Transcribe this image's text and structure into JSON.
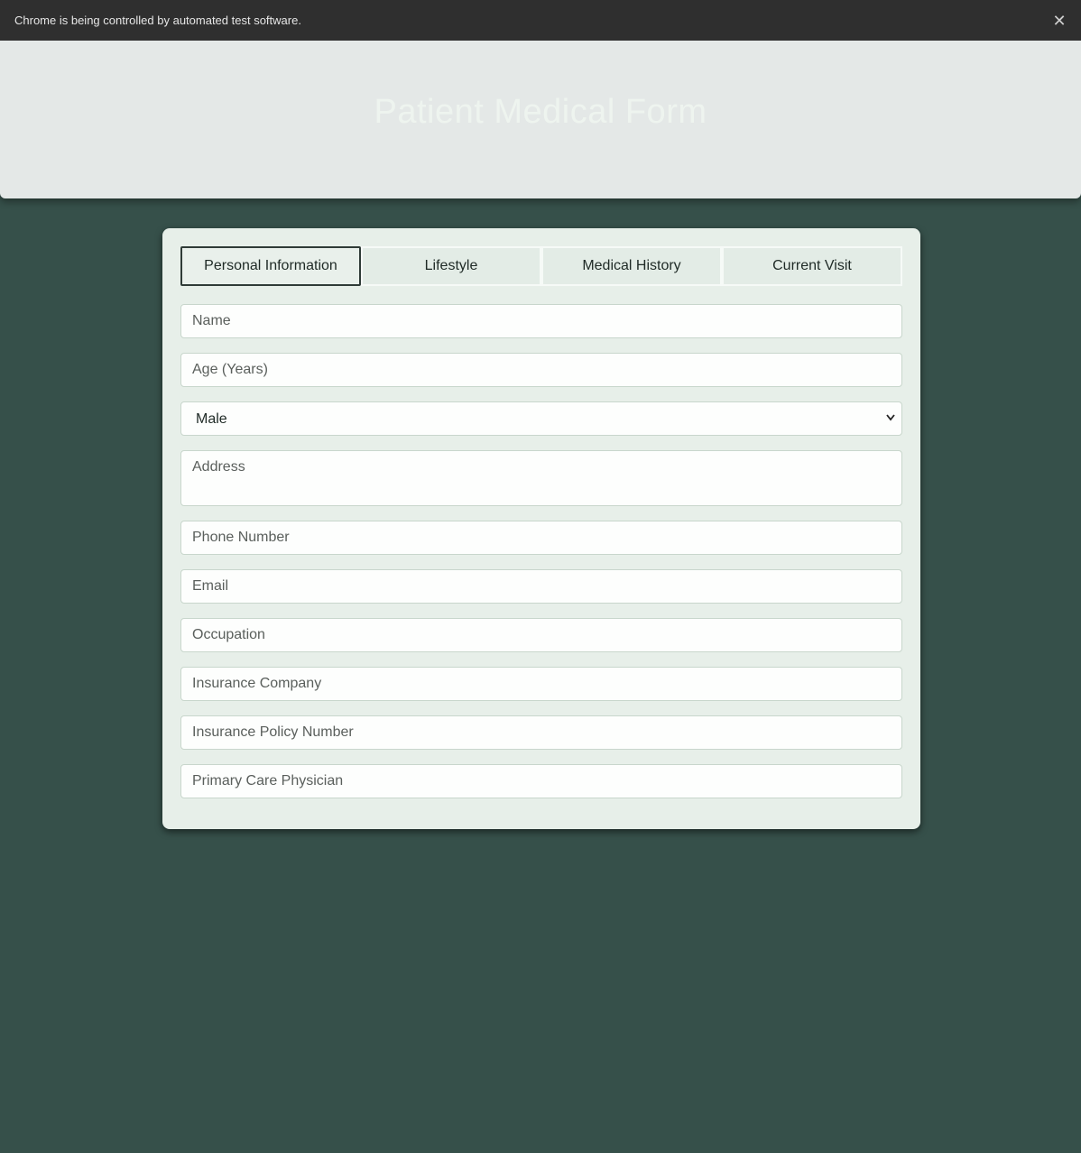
{
  "browser": {
    "automation_notice": "Chrome is being controlled by automated test software.",
    "close_icon": "close-icon"
  },
  "header": {
    "title": "Patient Medical Form"
  },
  "tabs": [
    {
      "label": "Personal Information",
      "active": true
    },
    {
      "label": "Lifestyle",
      "active": false
    },
    {
      "label": "Medical History",
      "active": false
    },
    {
      "label": "Current Visit",
      "active": false
    }
  ],
  "form": {
    "name": {
      "placeholder": "Name",
      "value": ""
    },
    "age": {
      "placeholder": "Age (Years)",
      "value": ""
    },
    "gender": {
      "selected": "Male"
    },
    "address": {
      "placeholder": "Address",
      "value": ""
    },
    "phone": {
      "placeholder": "Phone Number",
      "value": ""
    },
    "email": {
      "placeholder": "Email",
      "value": ""
    },
    "occupation": {
      "placeholder": "Occupation",
      "value": ""
    },
    "insurance_company": {
      "placeholder": "Insurance Company",
      "value": ""
    },
    "insurance_policy": {
      "placeholder": "Insurance Policy Number",
      "value": ""
    },
    "physician": {
      "placeholder": "Primary Care Physician",
      "value": ""
    }
  },
  "colors": {
    "background": "#36504a",
    "header_bg": "#e4e8e7",
    "card_bg": "#e7efe9",
    "active_tab_border": "#2f3b37"
  }
}
